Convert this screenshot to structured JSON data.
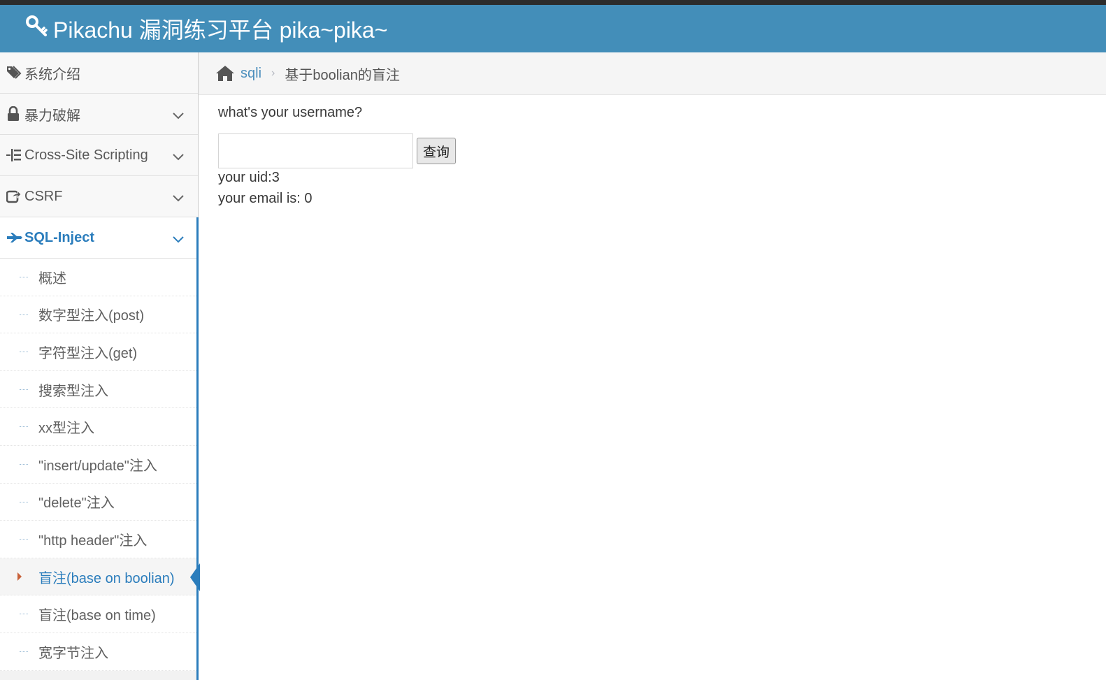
{
  "header": {
    "brand_icon": "key-icon",
    "title": "Pikachu 漏洞练习平台 pika~pika~"
  },
  "sidebar": {
    "items": [
      {
        "label": "系统介绍",
        "icon": "tags-icon"
      },
      {
        "label": "暴力破解",
        "icon": "lock-icon"
      },
      {
        "label": "Cross-Site Scripting",
        "icon": "list-tree-icon"
      },
      {
        "label": "CSRF",
        "icon": "share-square-icon"
      },
      {
        "label": "SQL-Inject",
        "icon": "fighter-jet-icon"
      }
    ],
    "submenu": [
      "概述",
      "数字型注入(post)",
      "字符型注入(get)",
      "搜索型注入",
      "xx型注入",
      "\"insert/update\"注入",
      "\"delete\"注入",
      "\"http header\"注入",
      "盲注(base on boolian)",
      "盲注(base on time)",
      "宽字节注入"
    ],
    "active_submenu": "盲注(base on boolian)"
  },
  "breadcrumb": {
    "link": "sqli",
    "current": "基于boolian的盲注"
  },
  "form": {
    "prompt": "what's your username?",
    "input_value": "",
    "submit_label": "查询"
  },
  "result": {
    "uid": "your uid:3",
    "email": "your email is: 0"
  },
  "colors": {
    "header": "#438eb9",
    "accent": "#2b7dbc",
    "top_strip": "#2c2c2c"
  }
}
